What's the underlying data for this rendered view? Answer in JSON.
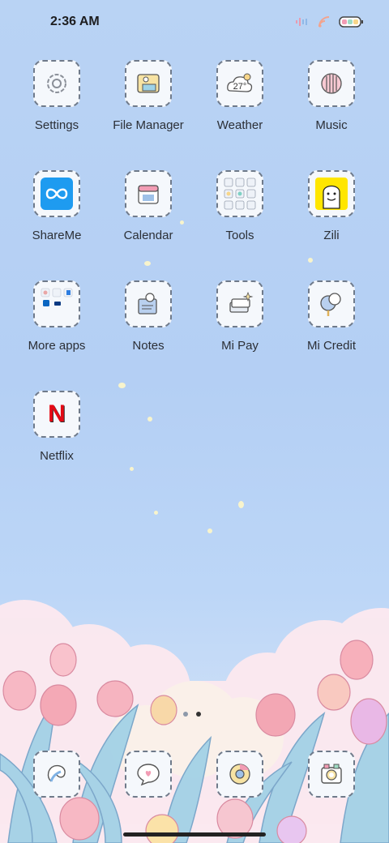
{
  "status_bar": {
    "time": "2:36 AM"
  },
  "apps": [
    {
      "label": "Settings",
      "icon": "settings-icon"
    },
    {
      "label": "File Manager",
      "icon": "file-manager-icon"
    },
    {
      "label": "Weather",
      "icon": "weather-icon",
      "temp": "27°"
    },
    {
      "label": "Music",
      "icon": "music-icon"
    },
    {
      "label": "ShareMe",
      "icon": "shareme-icon"
    },
    {
      "label": "Calendar",
      "icon": "calendar-icon"
    },
    {
      "label": "Tools",
      "icon": "tools-folder-icon"
    },
    {
      "label": "Zili",
      "icon": "zili-icon"
    },
    {
      "label": "More apps",
      "icon": "more-apps-folder-icon"
    },
    {
      "label": "Notes",
      "icon": "notes-icon"
    },
    {
      "label": "Mi Pay",
      "icon": "mi-pay-icon"
    },
    {
      "label": "Mi Credit",
      "icon": "mi-credit-icon"
    },
    {
      "label": "Netflix",
      "icon": "netflix-icon",
      "glyph": "N"
    }
  ],
  "dock": [
    {
      "icon": "phone-icon"
    },
    {
      "icon": "messages-icon"
    },
    {
      "icon": "browser-icon"
    },
    {
      "icon": "camera-icon"
    }
  ],
  "page_indicator": {
    "pages": 2,
    "current": 2
  },
  "colors": {
    "shareme": "#1e9bf0",
    "zili": "#ffe600",
    "netflix": "#e50914"
  }
}
